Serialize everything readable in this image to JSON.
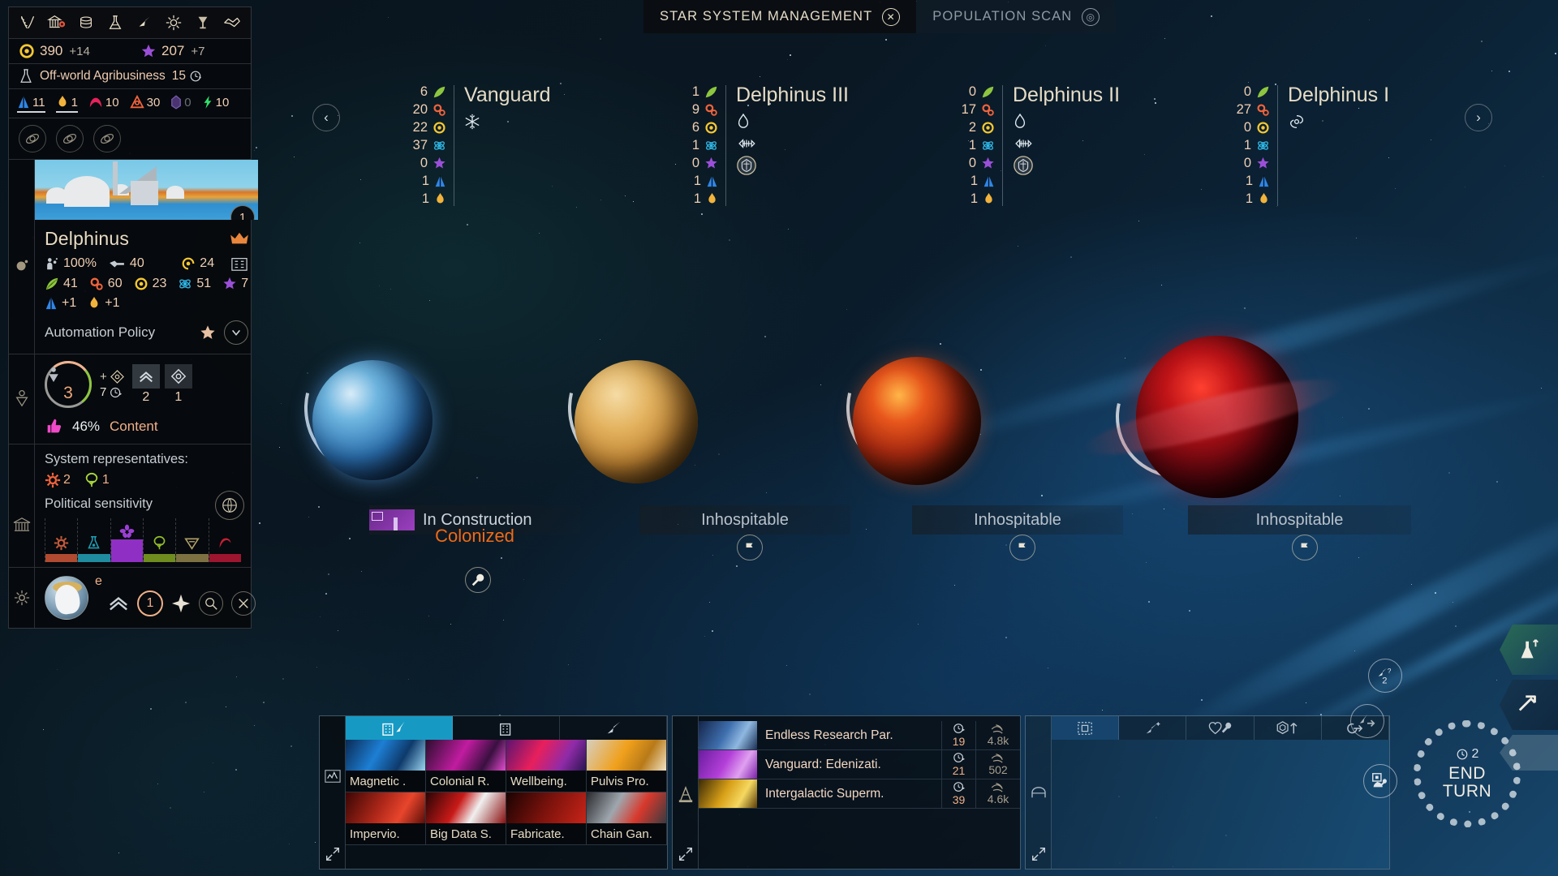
{
  "top_tabs": [
    {
      "label": "STAR SYSTEM MANAGEMENT",
      "icon": "close-icon",
      "glyph": "✕",
      "active": true
    },
    {
      "label": "POPULATION SCAN",
      "icon": "scan-icon",
      "glyph": "◎",
      "active": false
    }
  ],
  "empire_bar": {
    "icons": [
      "laurel-icon",
      "government-icon",
      "credits-icon",
      "science-icon",
      "navigation-icon",
      "influence-icon",
      "trophy-icon",
      "diplomacy-icon"
    ],
    "resources": [
      {
        "name": "dust",
        "value": "390",
        "delta": "+14",
        "color": "#f5c832"
      },
      {
        "name": "influence",
        "value": "207",
        "delta": "+7",
        "color": "#9b4fd8"
      }
    ],
    "research": {
      "label": "Off-world Agribusiness",
      "turns": "15",
      "icon": "flask-icon"
    },
    "strategics": [
      {
        "name": "titanium",
        "value": "11",
        "color": "#2f86e8",
        "underline": true
      },
      {
        "name": "hyperium",
        "value": "1",
        "color": "#f2b33c",
        "underline": true
      },
      {
        "name": "adamantian",
        "value": "10",
        "color": "#e8215a",
        "underline": false
      },
      {
        "name": "orichalcyx",
        "value": "30",
        "color": "#f0643c",
        "underline": false
      },
      {
        "name": "mercymium",
        "value": "0",
        "color": "#7a5bb0",
        "underline": false,
        "zero": true
      },
      {
        "name": "quadrinix",
        "value": "10",
        "color": "#2fe06a",
        "underline": false
      }
    ],
    "orbital_slots": [
      "orbital-slot-1",
      "orbital-slot-2",
      "orbital-slot-3"
    ]
  },
  "planet_card": {
    "name": "Delphinus",
    "crown_icon": "crown-icon",
    "badge": "1",
    "ownership_pct": "100%",
    "defense": "40",
    "approval_stat": "24",
    "stats": [
      {
        "name": "food",
        "value": "41",
        "color": "#8dc63f"
      },
      {
        "name": "industry",
        "value": "60",
        "color": "#f0643c"
      },
      {
        "name": "dust",
        "value": "23",
        "color": "#f5c832"
      },
      {
        "name": "science",
        "value": "51",
        "color": "#2fb8e8"
      },
      {
        "name": "influence",
        "value": "7",
        "color": "#9b4fd8"
      }
    ],
    "bonuses": [
      {
        "name": "titanium",
        "value": "+1",
        "color": "#2f86e8"
      },
      {
        "name": "hyperium",
        "value": "+1",
        "color": "#f2b33c"
      }
    ],
    "automation_label": "Automation Policy"
  },
  "population": {
    "count": "3",
    "growth_turns": "7",
    "slot_values": [
      "2",
      "1"
    ],
    "approval_pct": "46%",
    "approval_label": "Content"
  },
  "representatives": {
    "title": "System representatives:",
    "items": [
      {
        "name": "industrialist",
        "value": "2",
        "color": "#f0643c"
      },
      {
        "name": "ecologist",
        "value": "1",
        "color": "#a8d93a"
      }
    ],
    "political_title": "Political sensitivity",
    "parties": [
      {
        "name": "industrialist",
        "color": "#b04a30",
        "height": 10
      },
      {
        "name": "scientist",
        "color": "#1f8ca0",
        "height": 10
      },
      {
        "name": "pacifist",
        "color": "#8f2fc4",
        "height": 28
      },
      {
        "name": "ecologist",
        "color": "#6f8c1e",
        "height": 10
      },
      {
        "name": "religious",
        "color": "#7d7142",
        "height": 10
      },
      {
        "name": "militarist",
        "color": "#9e1530",
        "height": 10
      }
    ],
    "globe_icon": "globe-icon"
  },
  "hero": {
    "name": "e",
    "level": "1",
    "rank_icon": "chevron-rank-icon",
    "star_icon": "star-icon",
    "search_icon": "search-icon",
    "close_icon": "close-icon"
  },
  "system": {
    "prev_label": "‹",
    "next_label": "›",
    "planets": [
      {
        "name": "Vanguard",
        "stats": [
          {
            "name": "food",
            "value": "6",
            "color": "#8dc63f"
          },
          {
            "name": "industry",
            "value": "20",
            "color": "#f0643c"
          },
          {
            "name": "dust",
            "value": "22",
            "color": "#f5c832"
          },
          {
            "name": "science",
            "value": "37",
            "color": "#2fb8e8"
          },
          {
            "name": "influence",
            "value": "0",
            "color": "#9b4fd8"
          },
          {
            "name": "titanium",
            "value": "1",
            "color": "#2f86e8"
          },
          {
            "name": "hyperium",
            "value": "1",
            "color": "#f2b33c"
          }
        ],
        "anomalies": [
          "snowflake-icon"
        ],
        "status": "In Construction",
        "status_sub": "Colonized",
        "colonized": true,
        "body_color": "ocean"
      },
      {
        "name": "Delphinus III",
        "stats": [
          {
            "name": "food",
            "value": "1",
            "color": "#8dc63f"
          },
          {
            "name": "industry",
            "value": "9",
            "color": "#f0643c"
          },
          {
            "name": "dust",
            "value": "6",
            "color": "#f5c832"
          },
          {
            "name": "science",
            "value": "1",
            "color": "#2fb8e8"
          },
          {
            "name": "influence",
            "value": "0",
            "color": "#9b4fd8"
          },
          {
            "name": "titanium",
            "value": "1",
            "color": "#2f86e8"
          },
          {
            "name": "hyperium",
            "value": "1",
            "color": "#f2b33c"
          }
        ],
        "anomalies": [
          "flame-icon",
          "fishbone-icon",
          "shield-emblem-icon"
        ],
        "status": "Inhospitable",
        "status_sub": "",
        "colonized": false,
        "body_color": "desert"
      },
      {
        "name": "Delphinus II",
        "stats": [
          {
            "name": "food",
            "value": "0",
            "color": "#8dc63f"
          },
          {
            "name": "industry",
            "value": "17",
            "color": "#f0643c"
          },
          {
            "name": "dust",
            "value": "2",
            "color": "#f5c832"
          },
          {
            "name": "science",
            "value": "1",
            "color": "#2fb8e8"
          },
          {
            "name": "influence",
            "value": "0",
            "color": "#9b4fd8"
          },
          {
            "name": "titanium",
            "value": "1",
            "color": "#2f86e8"
          },
          {
            "name": "hyperium",
            "value": "1",
            "color": "#f2b33c"
          }
        ],
        "anomalies": [
          "flame-icon",
          "fishbone-icon",
          "shield-emblem-icon"
        ],
        "status": "Inhospitable",
        "status_sub": "",
        "colonized": false,
        "body_color": "lava"
      },
      {
        "name": "Delphinus I",
        "stats": [
          {
            "name": "food",
            "value": "0",
            "color": "#8dc63f"
          },
          {
            "name": "industry",
            "value": "27",
            "color": "#f0643c"
          },
          {
            "name": "dust",
            "value": "0",
            "color": "#f5c832"
          },
          {
            "name": "science",
            "value": "1",
            "color": "#2fb8e8"
          },
          {
            "name": "influence",
            "value": "0",
            "color": "#9b4fd8"
          },
          {
            "name": "titanium",
            "value": "1",
            "color": "#2f86e8"
          },
          {
            "name": "hyperium",
            "value": "1",
            "color": "#f2b33c"
          }
        ],
        "anomalies": [
          "cyclone-icon"
        ],
        "status": "Inhospitable",
        "status_sub": "",
        "colonized": false,
        "body_color": "red-gas"
      }
    ]
  },
  "construction_panel": {
    "rail_icon": "chart-icon",
    "expand_icon": "expand-icon",
    "tabs": [
      {
        "name": "buildings-and-ships",
        "icon": "building-rocket-icon",
        "active": true
      },
      {
        "name": "buildings",
        "icon": "building-icon",
        "active": false
      },
      {
        "name": "ships",
        "icon": "rocket-icon",
        "active": false
      }
    ],
    "cards": [
      {
        "label": "Magnetic .",
        "thumb": "blue-grid"
      },
      {
        "label": "Colonial R.",
        "thumb": "magenta-city"
      },
      {
        "label": "Wellbeing.",
        "thumb": "pink-robot"
      },
      {
        "label": "Pulvis Pro.",
        "thumb": "orange-container"
      },
      {
        "label": "Impervio.",
        "thumb": "red-canyon"
      },
      {
        "label": "Big Data S.",
        "thumb": "red-crystal"
      },
      {
        "label": "Fabricate.",
        "thumb": "red-troops"
      },
      {
        "label": "Chain Gan.",
        "thumb": "red-prisoners"
      }
    ]
  },
  "research_panel": {
    "rail_icon": "construction-cone-icon",
    "expand_icon": "expand-icon",
    "items": [
      {
        "label": "Endless Research Par.",
        "turns": "19",
        "cost": "4.8k",
        "thumb": "blue-city"
      },
      {
        "label": "Vanguard: Edenizati.",
        "turns": "21",
        "cost": "502",
        "thumb": "purple-plate"
      },
      {
        "label": "Intergalactic Superm.",
        "turns": "39",
        "cost": "4.6k",
        "thumb": "gold-hex"
      }
    ],
    "turn_icon": "clock-icon",
    "cost_icon": "science-wave-icon"
  },
  "fleet_panel": {
    "rail_icon": "hangar-icon",
    "expand_icon": "expand-icon",
    "tabs": [
      {
        "name": "selection",
        "icon": "selection-box-icon",
        "highlight": true
      },
      {
        "name": "new-ship",
        "icon": "rocket-star-icon",
        "highlight": false
      },
      {
        "name": "repair",
        "icon": "heart-wrench-icon",
        "highlight": false
      },
      {
        "name": "upgrade",
        "icon": "hex-arrow-icon",
        "highlight": false
      },
      {
        "name": "move",
        "icon": "target-arrow-icon",
        "highlight": false
      }
    ]
  },
  "right_controls": {
    "notches": [
      {
        "name": "research-notch",
        "icon": "flask-up-icon"
      },
      {
        "name": "construction-notch",
        "icon": "hammer-icon"
      },
      {
        "name": "empty-notch",
        "icon": ""
      }
    ],
    "end_turn": {
      "timer": "2",
      "label_line1": "END",
      "label_line2": "TURN",
      "clock_icon": "clock-icon"
    },
    "side_buttons": [
      {
        "name": "idle-ships-button",
        "icon": "rocket-question-icon",
        "badge": "2"
      },
      {
        "name": "move-ships-button",
        "icon": "rocket-arrow-icon",
        "badge": ""
      },
      {
        "name": "pending-build-button",
        "icon": "hand-build-icon",
        "badge": ""
      }
    ]
  }
}
